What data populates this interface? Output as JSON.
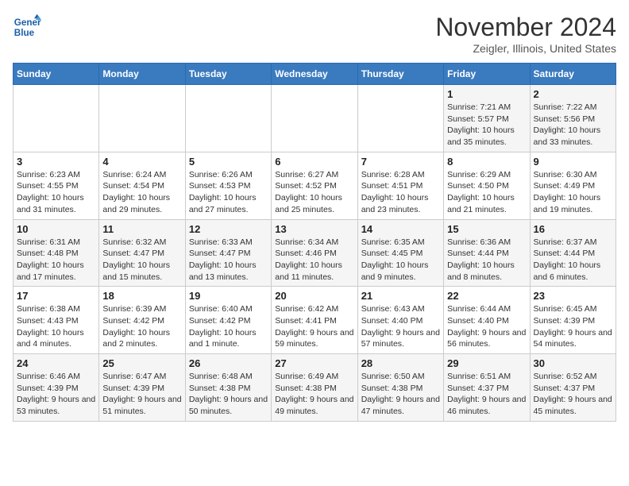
{
  "logo": {
    "line1": "General",
    "line2": "Blue"
  },
  "header": {
    "title": "November 2024",
    "location": "Zeigler, Illinois, United States"
  },
  "days_of_week": [
    "Sunday",
    "Monday",
    "Tuesday",
    "Wednesday",
    "Thursday",
    "Friday",
    "Saturday"
  ],
  "weeks": [
    [
      {
        "day": "",
        "info": ""
      },
      {
        "day": "",
        "info": ""
      },
      {
        "day": "",
        "info": ""
      },
      {
        "day": "",
        "info": ""
      },
      {
        "day": "",
        "info": ""
      },
      {
        "day": "1",
        "info": "Sunrise: 7:21 AM\nSunset: 5:57 PM\nDaylight: 10 hours and 35 minutes."
      },
      {
        "day": "2",
        "info": "Sunrise: 7:22 AM\nSunset: 5:56 PM\nDaylight: 10 hours and 33 minutes."
      }
    ],
    [
      {
        "day": "3",
        "info": "Sunrise: 6:23 AM\nSunset: 4:55 PM\nDaylight: 10 hours and 31 minutes."
      },
      {
        "day": "4",
        "info": "Sunrise: 6:24 AM\nSunset: 4:54 PM\nDaylight: 10 hours and 29 minutes."
      },
      {
        "day": "5",
        "info": "Sunrise: 6:26 AM\nSunset: 4:53 PM\nDaylight: 10 hours and 27 minutes."
      },
      {
        "day": "6",
        "info": "Sunrise: 6:27 AM\nSunset: 4:52 PM\nDaylight: 10 hours and 25 minutes."
      },
      {
        "day": "7",
        "info": "Sunrise: 6:28 AM\nSunset: 4:51 PM\nDaylight: 10 hours and 23 minutes."
      },
      {
        "day": "8",
        "info": "Sunrise: 6:29 AM\nSunset: 4:50 PM\nDaylight: 10 hours and 21 minutes."
      },
      {
        "day": "9",
        "info": "Sunrise: 6:30 AM\nSunset: 4:49 PM\nDaylight: 10 hours and 19 minutes."
      }
    ],
    [
      {
        "day": "10",
        "info": "Sunrise: 6:31 AM\nSunset: 4:48 PM\nDaylight: 10 hours and 17 minutes."
      },
      {
        "day": "11",
        "info": "Sunrise: 6:32 AM\nSunset: 4:47 PM\nDaylight: 10 hours and 15 minutes."
      },
      {
        "day": "12",
        "info": "Sunrise: 6:33 AM\nSunset: 4:47 PM\nDaylight: 10 hours and 13 minutes."
      },
      {
        "day": "13",
        "info": "Sunrise: 6:34 AM\nSunset: 4:46 PM\nDaylight: 10 hours and 11 minutes."
      },
      {
        "day": "14",
        "info": "Sunrise: 6:35 AM\nSunset: 4:45 PM\nDaylight: 10 hours and 9 minutes."
      },
      {
        "day": "15",
        "info": "Sunrise: 6:36 AM\nSunset: 4:44 PM\nDaylight: 10 hours and 8 minutes."
      },
      {
        "day": "16",
        "info": "Sunrise: 6:37 AM\nSunset: 4:44 PM\nDaylight: 10 hours and 6 minutes."
      }
    ],
    [
      {
        "day": "17",
        "info": "Sunrise: 6:38 AM\nSunset: 4:43 PM\nDaylight: 10 hours and 4 minutes."
      },
      {
        "day": "18",
        "info": "Sunrise: 6:39 AM\nSunset: 4:42 PM\nDaylight: 10 hours and 2 minutes."
      },
      {
        "day": "19",
        "info": "Sunrise: 6:40 AM\nSunset: 4:42 PM\nDaylight: 10 hours and 1 minute."
      },
      {
        "day": "20",
        "info": "Sunrise: 6:42 AM\nSunset: 4:41 PM\nDaylight: 9 hours and 59 minutes."
      },
      {
        "day": "21",
        "info": "Sunrise: 6:43 AM\nSunset: 4:40 PM\nDaylight: 9 hours and 57 minutes."
      },
      {
        "day": "22",
        "info": "Sunrise: 6:44 AM\nSunset: 4:40 PM\nDaylight: 9 hours and 56 minutes."
      },
      {
        "day": "23",
        "info": "Sunrise: 6:45 AM\nSunset: 4:39 PM\nDaylight: 9 hours and 54 minutes."
      }
    ],
    [
      {
        "day": "24",
        "info": "Sunrise: 6:46 AM\nSunset: 4:39 PM\nDaylight: 9 hours and 53 minutes."
      },
      {
        "day": "25",
        "info": "Sunrise: 6:47 AM\nSunset: 4:39 PM\nDaylight: 9 hours and 51 minutes."
      },
      {
        "day": "26",
        "info": "Sunrise: 6:48 AM\nSunset: 4:38 PM\nDaylight: 9 hours and 50 minutes."
      },
      {
        "day": "27",
        "info": "Sunrise: 6:49 AM\nSunset: 4:38 PM\nDaylight: 9 hours and 49 minutes."
      },
      {
        "day": "28",
        "info": "Sunrise: 6:50 AM\nSunset: 4:38 PM\nDaylight: 9 hours and 47 minutes."
      },
      {
        "day": "29",
        "info": "Sunrise: 6:51 AM\nSunset: 4:37 PM\nDaylight: 9 hours and 46 minutes."
      },
      {
        "day": "30",
        "info": "Sunrise: 6:52 AM\nSunset: 4:37 PM\nDaylight: 9 hours and 45 minutes."
      }
    ]
  ]
}
